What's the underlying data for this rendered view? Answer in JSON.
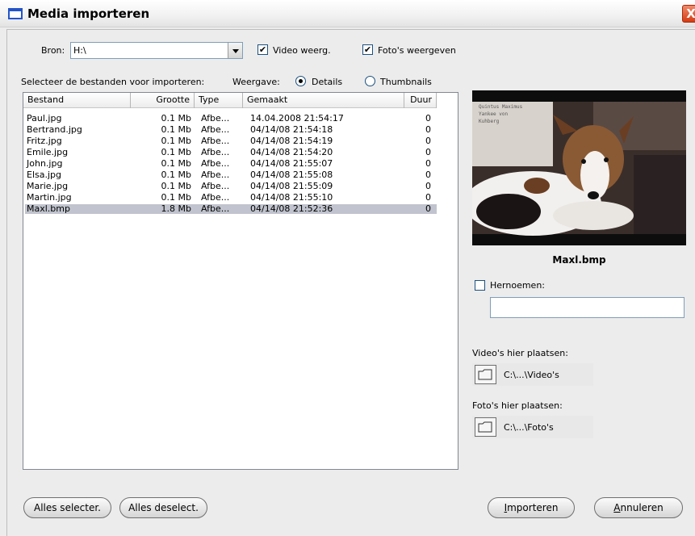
{
  "window": {
    "title": "Media importeren",
    "close_label": "X"
  },
  "source": {
    "label": "Bron:",
    "value": "H:\\"
  },
  "options": {
    "show_video": {
      "label": "Video weerg.",
      "checked": true
    },
    "show_photos": {
      "label": "Foto's weergeven",
      "checked": true
    }
  },
  "select_label": "Selecteer de bestanden voor importeren:",
  "view": {
    "label": "Weergave:",
    "details_label": "Details",
    "thumbnails_label": "Thumbnails",
    "selected": "Details"
  },
  "table": {
    "columns": [
      "Bestand",
      "Grootte",
      "Type",
      "Gemaakt",
      "Duur"
    ],
    "rows": [
      {
        "name": "Paul.jpg",
        "size": "0.1 Mb",
        "type": "Afbe...",
        "created": "14.04.2008 21:54:17",
        "duration": "0"
      },
      {
        "name": "Bertrand.jpg",
        "size": "0.1 Mb",
        "type": "Afbe...",
        "created": "04/14/08 21:54:18",
        "duration": "0"
      },
      {
        "name": "Fritz.jpg",
        "size": "0.1 Mb",
        "type": "Afbe...",
        "created": "04/14/08 21:54:19",
        "duration": "0"
      },
      {
        "name": "Emile.jpg",
        "size": "0.1 Mb",
        "type": "Afbe...",
        "created": "04/14/08 21:54:20",
        "duration": "0"
      },
      {
        "name": "John.jpg",
        "size": "0.1 Mb",
        "type": "Afbe...",
        "created": "04/14/08 21:55:07",
        "duration": "0"
      },
      {
        "name": "Elsa.jpg",
        "size": "0.1 Mb",
        "type": "Afbe...",
        "created": "04/14/08 21:55:08",
        "duration": "0"
      },
      {
        "name": "Marie.jpg",
        "size": "0.1 Mb",
        "type": "Afbe...",
        "created": "04/14/08 21:55:09",
        "duration": "0"
      },
      {
        "name": "Martin.jpg",
        "size": "0.1 Mb",
        "type": "Afbe...",
        "created": "04/14/08 21:55:10",
        "duration": "0"
      },
      {
        "name": "Maxl.bmp",
        "size": "1.8 Mb",
        "type": "Afbe...",
        "created": "04/14/08 21:52:36",
        "duration": "0",
        "selected": true
      }
    ]
  },
  "preview": {
    "overlay_lines": [
      "Quintus Maximus",
      "Yankee von",
      "Kuhberg"
    ],
    "caption": "Maxl.bmp"
  },
  "rename": {
    "label": "Hernoemen:",
    "checked": false,
    "value": ""
  },
  "video_target": {
    "label": "Video's hier plaatsen:",
    "path": "C:\\...\\Video's"
  },
  "photo_target": {
    "label": "Foto's hier plaatsen:",
    "path": "C:\\...\\Foto's"
  },
  "buttons": {
    "select_all": "Alles selecter.",
    "deselect_all": "Alles deselect.",
    "import_first": "I",
    "import_rest": "mporteren",
    "cancel_first": "A",
    "cancel_rest": "nnuleren"
  },
  "colors": {
    "title_icon": "#2354c9",
    "close_button": "#d43c14",
    "selected_row": "#c1c4ce"
  }
}
